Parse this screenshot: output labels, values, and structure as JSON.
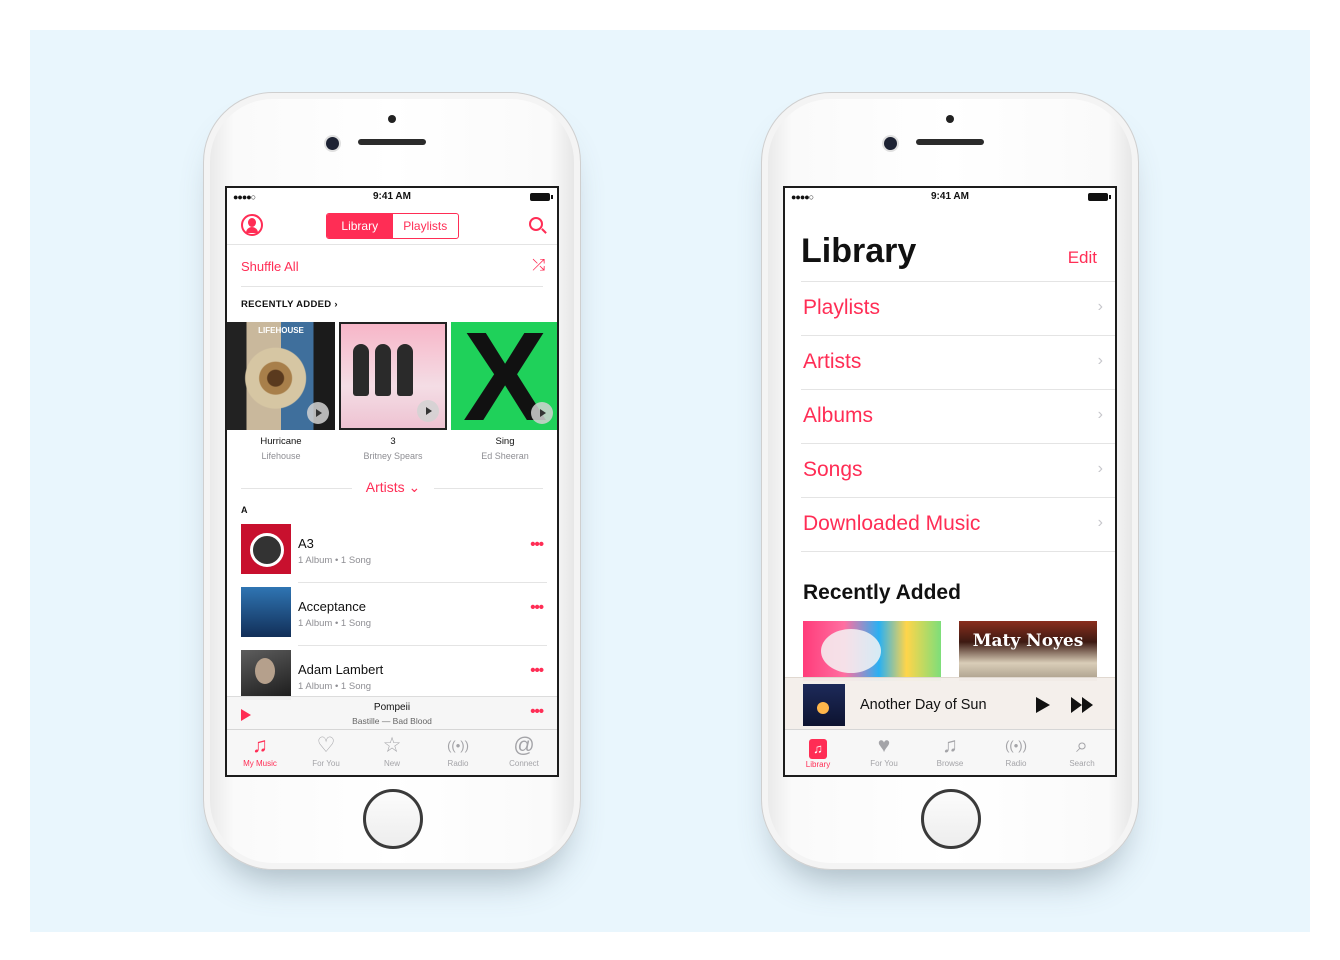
{
  "status_bar": {
    "signal": "●●●●○",
    "time": "9:41 AM"
  },
  "left_phone": {
    "segments": {
      "library": "Library",
      "playlists": "Playlists"
    },
    "shuffle_label": "Shuffle All",
    "shuffle_icon": "⤮",
    "recently_added_header": "RECENTLY ADDED ›",
    "albums": [
      {
        "title": "Hurricane",
        "artist": "Lifehouse",
        "art_text": "LIFEHOUSE"
      },
      {
        "title": "3",
        "artist": "Britney Spears"
      },
      {
        "title": "Sing",
        "artist": "Ed Sheeran",
        "art_text": "X"
      }
    ],
    "artists_label": "Artists ⌄",
    "section_letter": "A",
    "artists": [
      {
        "name": "A3",
        "meta": "1 Album • 1 Song"
      },
      {
        "name": "Acceptance",
        "meta": "1 Album • 1 Song"
      },
      {
        "name": "Adam Lambert",
        "meta": "1 Album • 1 Song"
      }
    ],
    "more_glyph": "•••",
    "mini_player": {
      "title": "Pompeii",
      "subtitle": "Bastille — Bad Blood"
    },
    "tabs": [
      {
        "label": "My Music",
        "icon": "♫"
      },
      {
        "label": "For You",
        "icon": "♡"
      },
      {
        "label": "New",
        "icon": "☆"
      },
      {
        "label": "Radio",
        "icon": "((•))"
      },
      {
        "label": "Connect",
        "icon": "@"
      }
    ]
  },
  "right_phone": {
    "title": "Library",
    "edit_label": "Edit",
    "items": [
      {
        "label": "Playlists"
      },
      {
        "label": "Artists"
      },
      {
        "label": "Albums"
      },
      {
        "label": "Songs"
      },
      {
        "label": "Downloaded Music"
      }
    ],
    "chevron": "›",
    "recently_added_title": "Recently Added",
    "recent_art_text": "Maty Noyes",
    "now_playing": {
      "title": "Another Day of Sun"
    },
    "tabs": [
      {
        "label": "Library",
        "icon": "♫"
      },
      {
        "label": "For You",
        "icon": "♥"
      },
      {
        "label": "Browse",
        "icon": "♫"
      },
      {
        "label": "Radio",
        "icon": "((•))"
      },
      {
        "label": "Search",
        "icon": "⌕"
      }
    ]
  },
  "colors": {
    "accent": "#ff2d55",
    "background": "#e9f6fd",
    "secondary_text": "#8e8e93"
  }
}
